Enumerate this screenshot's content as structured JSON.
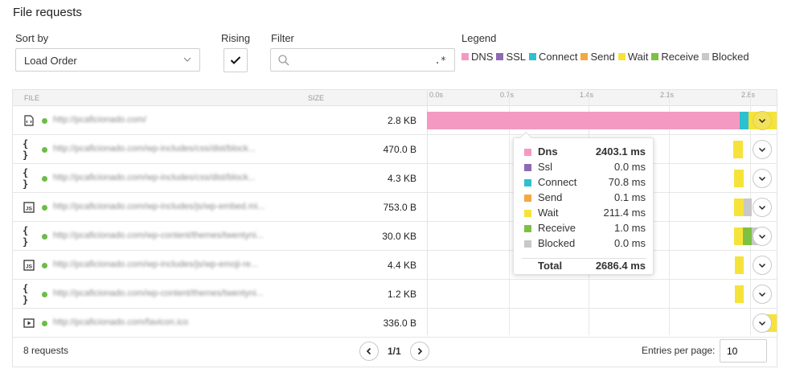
{
  "page": {
    "title": "File requests"
  },
  "controls": {
    "sort_label": "Sort by",
    "sort_value": "Load Order",
    "rising_label": "Rising",
    "rising_checked": true,
    "filter_label": "Filter",
    "filter_value": "",
    "filter_placeholder": "",
    "regex_symbol": ".*",
    "legend_label": "Legend"
  },
  "legend": [
    {
      "label": "DNS",
      "color": "#f49ac2"
    },
    {
      "label": "SSL",
      "color": "#8e6ab5"
    },
    {
      "label": "Connect",
      "color": "#2ebfd1"
    },
    {
      "label": "Send",
      "color": "#f5a742"
    },
    {
      "label": "Wait",
      "color": "#f5e33a"
    },
    {
      "label": "Receive",
      "color": "#7dc142"
    },
    {
      "label": "Blocked",
      "color": "#c8c8c8"
    }
  ],
  "table": {
    "col_file": "FILE",
    "col_size": "SIZE",
    "ticks": [
      "0.0s",
      "0.7s",
      "1.4s",
      "2.1s",
      "2.8s"
    ],
    "rows": [
      {
        "type": "html-icon",
        "url": "http://pcaficionado.com/",
        "size": "2.8 KB"
      },
      {
        "type": "css-icon",
        "url": "http://pcaficionado.com/wp-includes/css/dist/block...",
        "size": "470.0 B"
      },
      {
        "type": "css-icon",
        "url": "http://pcaficionado.com/wp-includes/css/dist/block...",
        "size": "4.3 KB"
      },
      {
        "type": "js-icon",
        "url": "http://pcaficionado.com/wp-includes/js/wp-embed.mi...",
        "size": "753.0 B"
      },
      {
        "type": "css-icon",
        "url": "http://pcaficionado.com/wp-content/themes/twentyni...",
        "size": "30.0 KB"
      },
      {
        "type": "js-icon",
        "url": "http://pcaficionado.com/wp-includes/js/wp-emoji-re...",
        "size": "4.4 KB"
      },
      {
        "type": "css-icon",
        "url": "http://pcaficionado.com/wp-content/themes/twentyni...",
        "size": "1.2 KB"
      },
      {
        "type": "media-icon",
        "url": "http://pcaficionado.com/favicon.ico",
        "size": "336.0 B"
      }
    ]
  },
  "footer": {
    "requests": "8 requests",
    "page_indicator": "1/1",
    "entries_label": "Entries per page:",
    "entries_value": "10"
  },
  "tooltip": {
    "rows": [
      {
        "label": "Dns",
        "value": "2403.1 ms",
        "color": "#f49ac2",
        "bold": true
      },
      {
        "label": "Ssl",
        "value": "0.0 ms",
        "color": "#8e6ab5"
      },
      {
        "label": "Connect",
        "value": "70.8 ms",
        "color": "#2ebfd1"
      },
      {
        "label": "Send",
        "value": "0.1 ms",
        "color": "#f5a742"
      },
      {
        "label": "Wait",
        "value": "211.4 ms",
        "color": "#f5e33a"
      },
      {
        "label": "Receive",
        "value": "1.0 ms",
        "color": "#7dc142"
      },
      {
        "label": "Blocked",
        "value": "0.0 ms",
        "color": "#c8c8c8"
      }
    ],
    "total_label": "Total",
    "total_value": "2686.4 ms"
  }
}
